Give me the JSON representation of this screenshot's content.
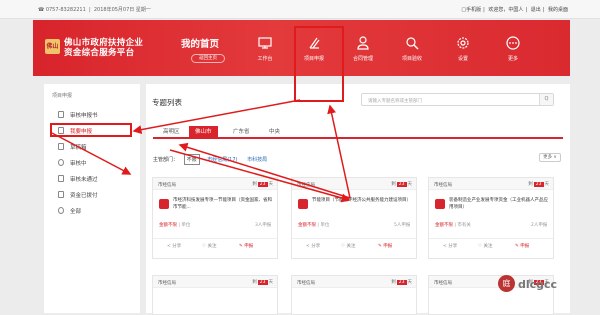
{
  "topbar": {
    "phone": "☎ 0757-83282211",
    "date": "2018年05月07日 星期一",
    "links": [
      "□手机版",
      "欢迎您，中国人",
      "退出",
      "我的桌面"
    ]
  },
  "header": {
    "logo_text": "佛山",
    "brand_line1": "佛山市政府扶持企业",
    "brand_line2": "资金综合服务平台",
    "home_title": "我的首页",
    "home_button": "返回主页"
  },
  "nav": [
    {
      "label": "工作台",
      "icon": "monitor-icon"
    },
    {
      "label": "项目申报",
      "icon": "edit-icon"
    },
    {
      "label": "合同管理",
      "icon": "contract-icon"
    },
    {
      "label": "项目验收",
      "icon": "search-icon"
    },
    {
      "label": "设置",
      "icon": "gear-icon"
    },
    {
      "label": "更多",
      "icon": "more-icon"
    }
  ],
  "sidebar": {
    "title": "项目申报",
    "items": [
      {
        "label": "审核申报书"
      },
      {
        "label": "我要申报"
      },
      {
        "label": "草稿箱"
      },
      {
        "label": "审核中"
      },
      {
        "label": "审核未通过"
      },
      {
        "label": "资金已拨付"
      },
      {
        "label": "全部"
      }
    ]
  },
  "main": {
    "title": "专题列表",
    "search_placeholder": "请输入专题名称或主管部门",
    "search_button": "Q",
    "tabs": [
      "高明区",
      "佛山市",
      "广东省",
      "中央"
    ],
    "filter_label": "主管部门：",
    "filter_options": [
      "不限",
      "市经信局(17)",
      "市科技局"
    ],
    "more_button": "更多 ∨"
  },
  "cards": [
    {
      "org": "市经信局",
      "days_prefix": "剩",
      "days": "23",
      "days_unit": "天",
      "name": "市经济科技发展专项—节能项目（资金国家、省和市节能...",
      "amount": "金额不限",
      "unit": "单位",
      "count": "3人申报",
      "share": "分享",
      "follow": "关注",
      "report": "申报"
    },
    {
      "org": "市经信局",
      "days_prefix": "剩",
      "days": "23",
      "days_unit": "天",
      "name": "节能项目（节能循环经济公共服务能力建设项目）",
      "amount": "金额不限",
      "unit": "单位",
      "count": "5人申报",
      "share": "分享",
      "follow": "关注",
      "report": "申报"
    },
    {
      "org": "市经信局",
      "days_prefix": "剩",
      "days": "23",
      "days_unit": "天",
      "name": "装备制造业产业发展专项资金（工业机器人产品应用项目）",
      "amount": "金额不限",
      "unit": "市有关",
      "count": "2人申报",
      "share": "分享",
      "follow": "关注",
      "report": "申报"
    },
    {
      "org": "市经信局",
      "days_prefix": "剩",
      "days": "23",
      "days_unit": "天"
    },
    {
      "org": "市经信局",
      "days_prefix": "剩",
      "days": "23",
      "days_unit": "天"
    },
    {
      "org": "市经信局",
      "days_prefix": "剩",
      "days": "23",
      "days_unit": "天"
    }
  ],
  "watermark": "dlcgcc",
  "colors": {
    "brand_red": "#d8242c",
    "annotation_red": "#e01b1b"
  }
}
